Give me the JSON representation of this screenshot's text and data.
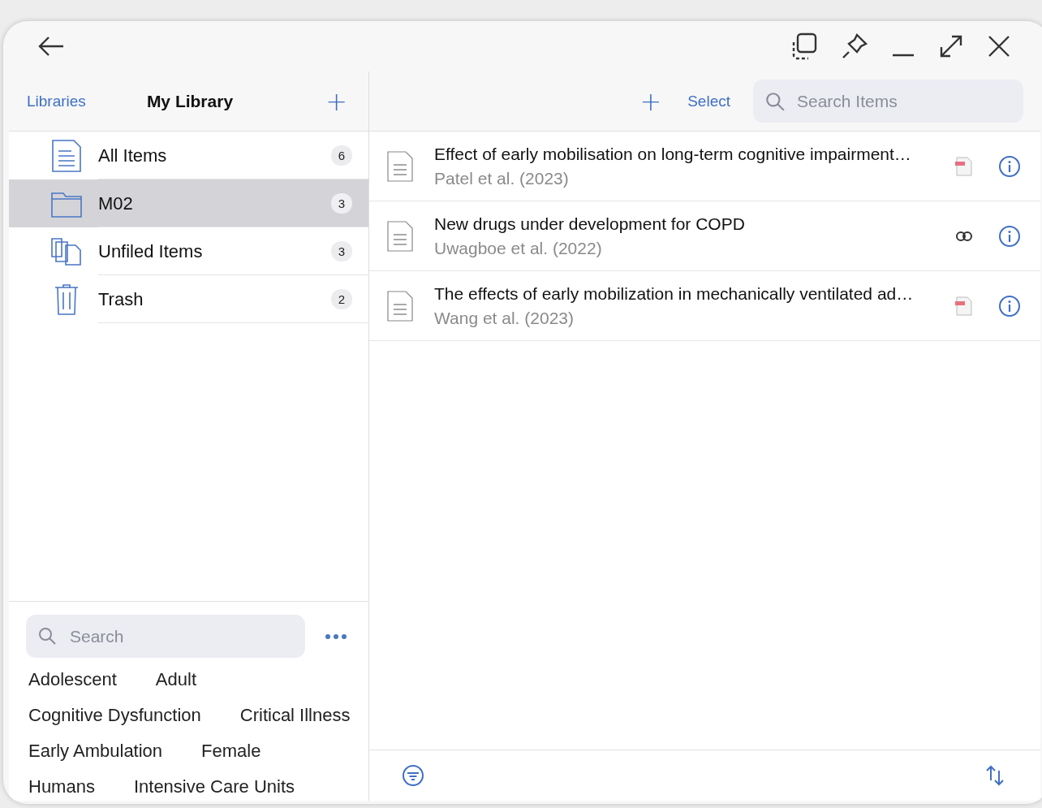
{
  "library_panel": {
    "back_link": "Libraries",
    "title": "My Library",
    "add_label": "+"
  },
  "collections": [
    {
      "label": "All Items",
      "count": "6",
      "kind": "document",
      "selected": false
    },
    {
      "label": "M02",
      "count": "3",
      "kind": "folder",
      "selected": true
    },
    {
      "label": "Unfiled Items",
      "count": "3",
      "kind": "unfiled",
      "selected": false
    },
    {
      "label": "Trash",
      "count": "2",
      "kind": "trash",
      "selected": false
    }
  ],
  "tag_search": {
    "placeholder": "Search"
  },
  "tags": [
    "Adolescent",
    "Adult",
    "Cognitive Dysfunction",
    "Critical Illness",
    "Early Ambulation",
    "Female",
    "Humans",
    "Intensive Care Units"
  ],
  "items_toolbar": {
    "add_label": "+",
    "select_label": "Select",
    "search_placeholder": "Search Items"
  },
  "items": [
    {
      "title": "Effect of early mobilisation on long-term cognitive impairment…",
      "creator": "Patel et al. (2023)",
      "kind": "pdf"
    },
    {
      "title": "New drugs under development for COPD",
      "creator": "Uwagboe et al. (2022)",
      "kind": "link"
    },
    {
      "title": "The effects of early mobilization in mechanically ventilated ad…",
      "creator": "Wang et al. (2023)",
      "kind": "pdf"
    }
  ]
}
